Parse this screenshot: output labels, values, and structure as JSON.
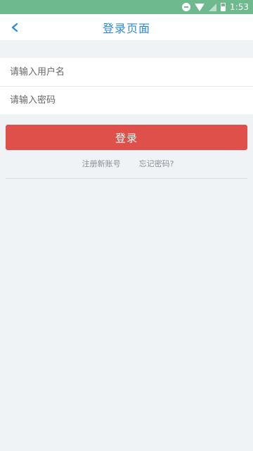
{
  "status_bar": {
    "time": "1:53",
    "icons": [
      "do-not-disturb-icon",
      "wifi-icon",
      "signal-icon",
      "battery-icon"
    ],
    "background": "#6fb98f"
  },
  "header": {
    "title": "登录页面",
    "back_icon": "chevron-left-icon",
    "title_color": "#2a8bd4"
  },
  "form": {
    "username_placeholder": "请输入用户名",
    "password_placeholder": "请输入密码",
    "username_value": "",
    "password_value": ""
  },
  "login_button": {
    "label": "登录",
    "color": "#e0504b"
  },
  "links": {
    "register": "注册新账号",
    "forgot_password": "忘记密码?"
  }
}
